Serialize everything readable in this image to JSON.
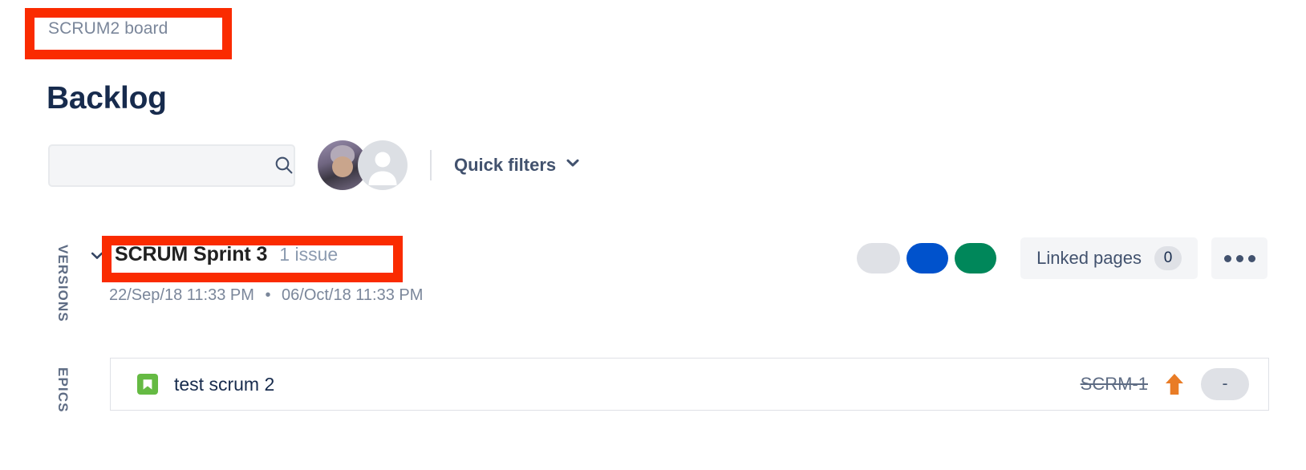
{
  "breadcrumb": {
    "board_label": "SCRUM2 board"
  },
  "page": {
    "title": "Backlog"
  },
  "toolbar": {
    "search": {
      "value": "",
      "placeholder": "",
      "icon": "search-icon"
    },
    "avatars": [
      {
        "name": "user-avatar-photo",
        "type": "photo"
      },
      {
        "name": "user-avatar-default",
        "type": "placeholder"
      }
    ],
    "quick_filters_label": "Quick filters",
    "quick_filters_icon": "chevron-down-icon"
  },
  "rails": {
    "versions_label": "VERSIONS",
    "epics_label": "EPICS"
  },
  "sprint": {
    "toggle_icon": "chevron-down-icon",
    "name": "SCRUM Sprint 3",
    "issue_count_label": "1 issue",
    "start_date": "22/Sep/18 11:33 PM",
    "date_separator": "•",
    "end_date": "06/Oct/18 11:33 PM",
    "status_pills": [
      {
        "name": "status-pill-todo",
        "color": "#DFE1E6"
      },
      {
        "name": "status-pill-inprogress",
        "color": "#0052CC"
      },
      {
        "name": "status-pill-done",
        "color": "#00875A"
      }
    ],
    "linked_pages_label": "Linked pages",
    "linked_pages_count": "0",
    "more_actions_icon": "ellipsis-icon"
  },
  "issues": [
    {
      "type_icon": "story-icon",
      "type_color": "#65BA43",
      "summary": "test scrum 2",
      "key": "SCRM-1",
      "key_struck_through": true,
      "priority_icon": "priority-high-arrow-up-icon",
      "priority_color": "#E97C26",
      "estimate": "-"
    }
  ],
  "annotations": [
    {
      "name": "annotation-breadcrumb",
      "color": "#FA2B00"
    },
    {
      "name": "annotation-sprint-name",
      "color": "#FA2B00"
    }
  ]
}
